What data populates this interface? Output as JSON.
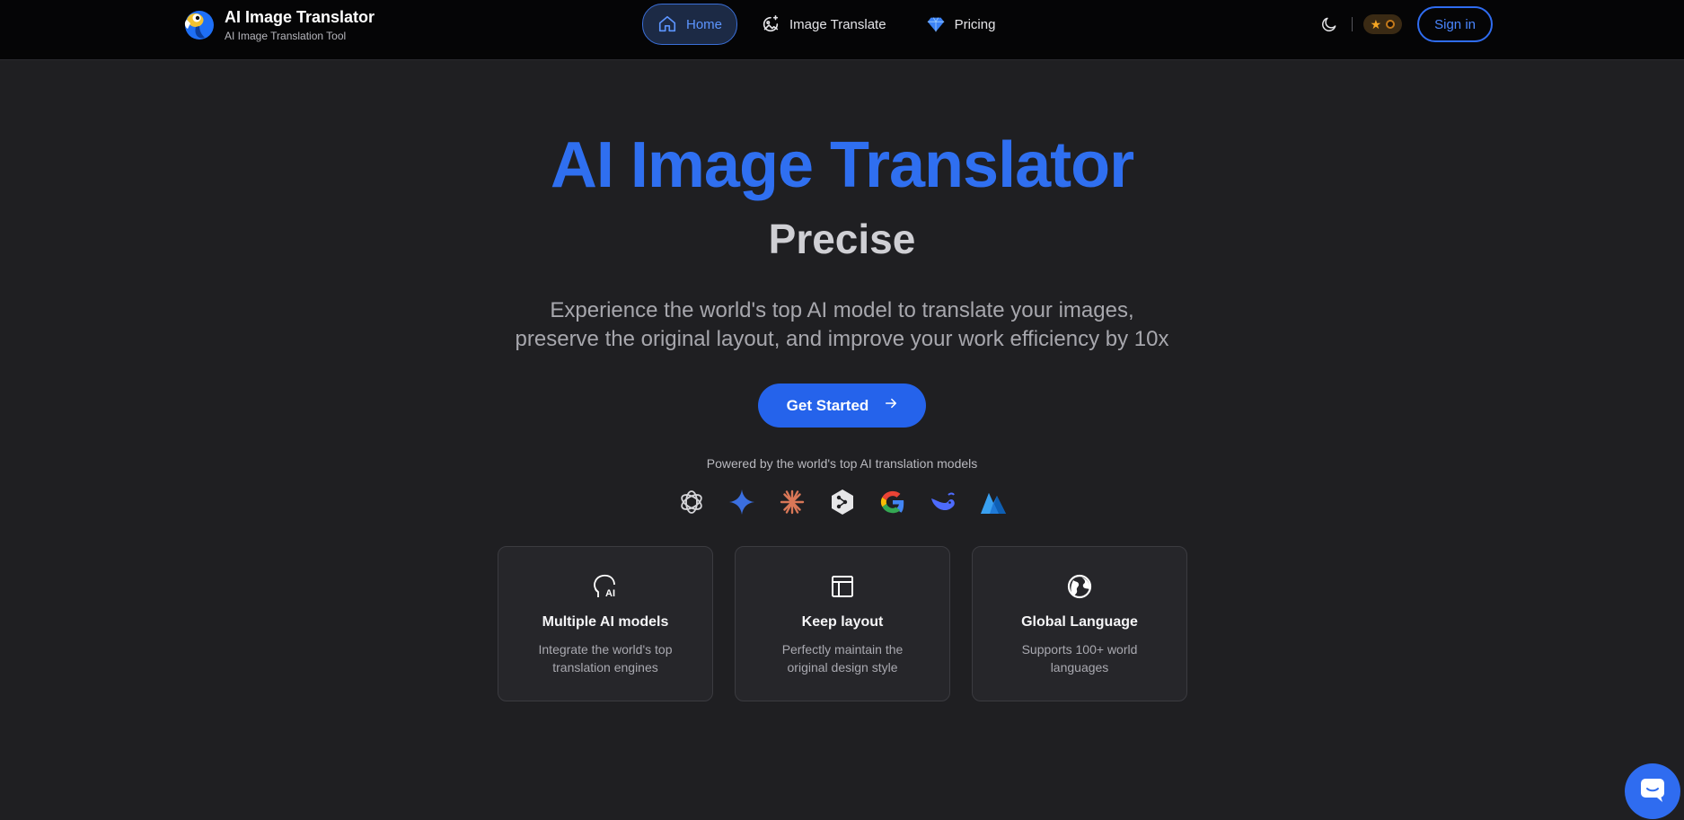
{
  "nav": {
    "brand_title": "AI Image Translator",
    "brand_subtitle": "AI Image Translation Tool",
    "links": [
      {
        "label": "Home",
        "icon": "home-icon",
        "active": true
      },
      {
        "label": "Image Translate",
        "icon": "sparkle-image-icon",
        "active": false
      },
      {
        "label": "Pricing",
        "icon": "diamond-icon",
        "active": false
      }
    ],
    "theme_icon": "moon-icon",
    "credits_icon": "star-icon",
    "signin_label": "Sign in"
  },
  "hero": {
    "title": "AI Image Translator",
    "subtitle": "Precise",
    "description_line1": "Experience the world's top AI model to translate your images,",
    "description_line2": "preserve the original layout, and improve your work efficiency by 10x",
    "cta_label": "Get Started",
    "cta_icon": "arrow-right-icon",
    "powered_by": "Powered by the world's top AI translation models"
  },
  "model_logos": [
    "openai-logo",
    "gemini-logo",
    "claude-logo",
    "deepl-logo",
    "google-logo",
    "deepseek-logo",
    "azure-logo"
  ],
  "features": [
    {
      "icon": "ai-head-icon",
      "title": "Multiple AI models",
      "desc": "Integrate the world's top translation engines"
    },
    {
      "icon": "layout-icon",
      "title": "Keep layout",
      "desc": "Perfectly maintain the original design style"
    },
    {
      "icon": "globe-icon",
      "title": "Global Language",
      "desc": "Supports 100+ world languages"
    }
  ],
  "chat_icon": "chat-icon",
  "colors": {
    "accent": "#2f6ff0",
    "background": "#1f1f22",
    "navbar": "#050506"
  }
}
